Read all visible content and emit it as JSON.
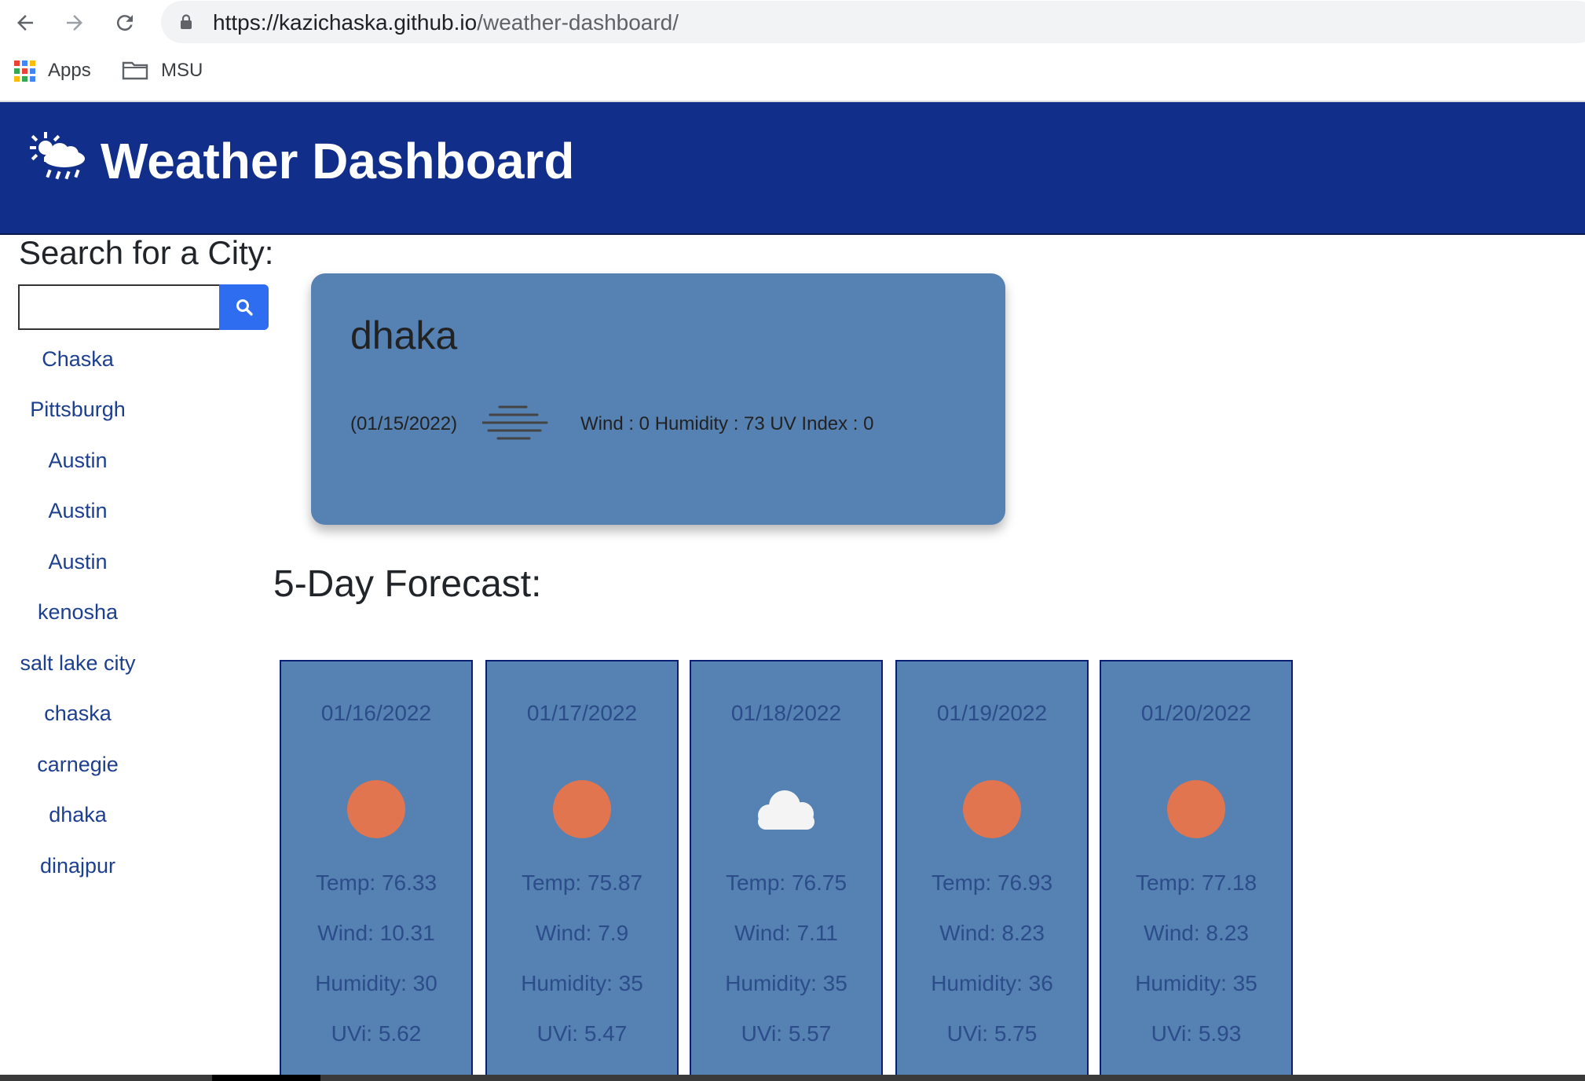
{
  "browser": {
    "url_host": "https://kazichaska.github.io",
    "url_path": "/weather-dashboard/",
    "bookmarks": [
      {
        "label": "Apps",
        "icon": "apps-grid-icon"
      },
      {
        "label": "MSU",
        "icon": "folder-icon"
      }
    ]
  },
  "header": {
    "title_bold": "Weather",
    "title_rest": " Dashboard",
    "logo_icon": "sun-cloud-rain-icon"
  },
  "sidebar": {
    "heading": "Search for a City:",
    "search_value": "",
    "search_button_icon": "search-icon",
    "history": [
      "Chaska",
      "Pittsburgh",
      "Austin",
      "Austin",
      "Austin",
      "kenosha",
      "salt lake city",
      "chaska",
      "carnegie",
      "dhaka",
      "dinajpur"
    ]
  },
  "current": {
    "city": "dhaka",
    "date": "(01/15/2022)",
    "icon": "mist-icon",
    "stats": "Wind : 0 Humidity : 73 UV Index : 0"
  },
  "forecast": {
    "heading": "5-Day Forecast:",
    "days": [
      {
        "date": "01/16/2022",
        "icon": "sun-icon",
        "temp": "Temp: 76.33",
        "wind": "Wind: 10.31",
        "humidity": "Humidity: 30",
        "uvi": "UVi: 5.62"
      },
      {
        "date": "01/17/2022",
        "icon": "sun-icon",
        "temp": "Temp: 75.87",
        "wind": "Wind: 7.9",
        "humidity": "Humidity: 35",
        "uvi": "UVi: 5.47"
      },
      {
        "date": "01/18/2022",
        "icon": "cloud-icon",
        "temp": "Temp: 76.75",
        "wind": "Wind: 7.11",
        "humidity": "Humidity: 35",
        "uvi": "UVi: 5.57"
      },
      {
        "date": "01/19/2022",
        "icon": "sun-icon",
        "temp": "Temp: 76.93",
        "wind": "Wind: 8.23",
        "humidity": "Humidity: 36",
        "uvi": "UVi: 5.75"
      },
      {
        "date": "01/20/2022",
        "icon": "sun-icon",
        "temp": "Temp: 77.18",
        "wind": "Wind: 8.23",
        "humidity": "Humidity: 35",
        "uvi": "UVi: 5.93"
      }
    ]
  },
  "colors": {
    "header_bg": "#112e8a",
    "card_bg": "#5581b3",
    "card_border": "#0a1f73",
    "sun": "#e07550",
    "link": "#1d3f8f",
    "search_button": "#2f6df0"
  }
}
